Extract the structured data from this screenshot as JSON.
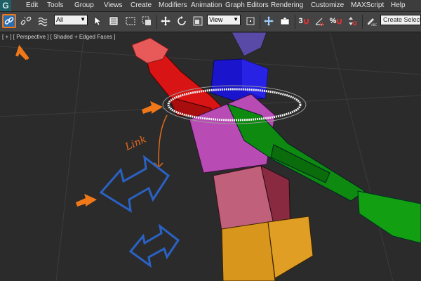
{
  "app": {
    "logo_letter": "G"
  },
  "menu": {
    "items": [
      "Edit",
      "Tools",
      "Group",
      "Views",
      "Create",
      "Modifiers",
      "Animation",
      "Graph Editors",
      "Rendering",
      "Customize",
      "MAXScript",
      "Help"
    ]
  },
  "toolbar": {
    "selection_filter": "All",
    "ref_coord_system": "View",
    "named_selection_placeholder": "Create Selection",
    "percent_snap_label": "%",
    "snap_angle_label": "3",
    "active_tool": "select-and-link"
  },
  "viewport": {
    "label": "[ + ] [ Perspective ] [ Shaded + Edged Faces ]",
    "annotation_text": "Link"
  },
  "colors": {
    "accent_orange": "#f07818",
    "annotation_blue": "#2a62c4",
    "active_button": "#2a6db0"
  }
}
